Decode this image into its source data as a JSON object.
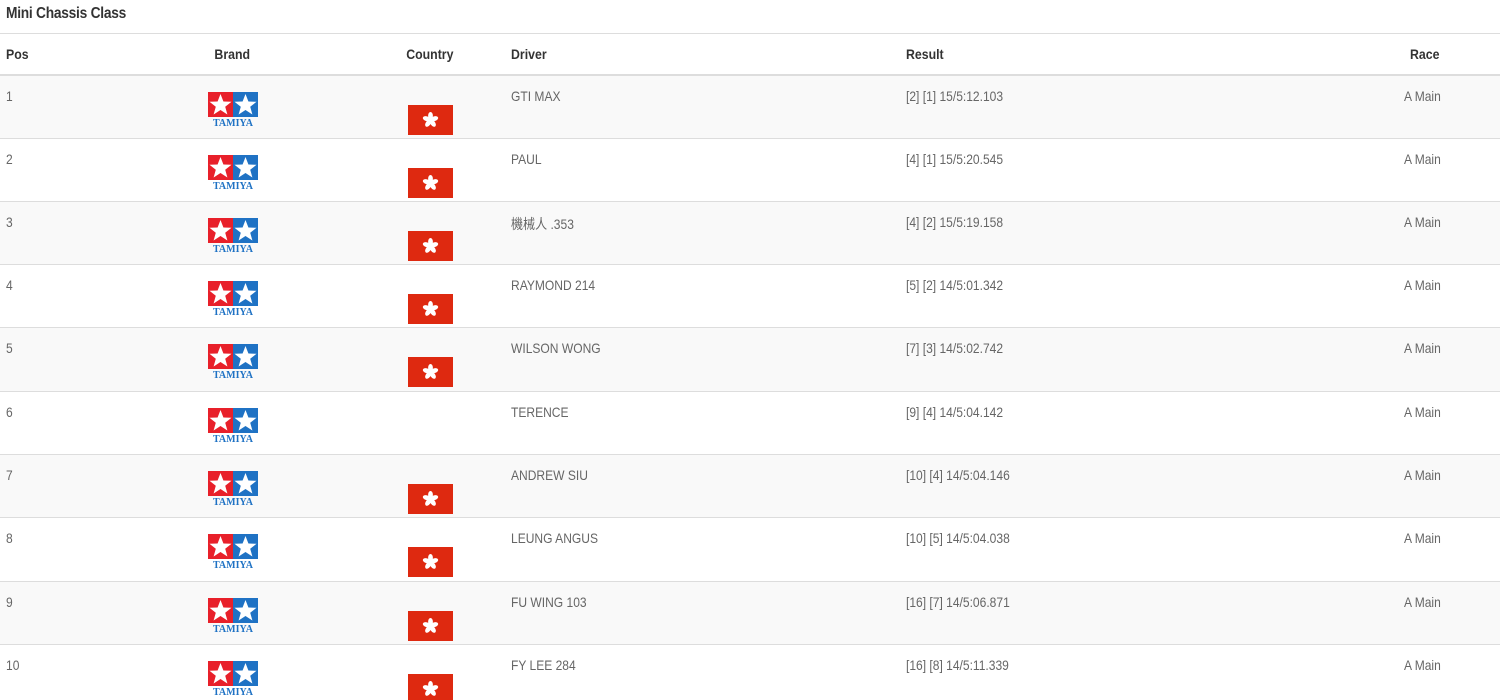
{
  "section": {
    "title": "Mini Chassis Class"
  },
  "columns": {
    "pos": "Pos",
    "brand": "Brand",
    "country": "Country",
    "driver": "Driver",
    "result": "Result",
    "race": "Race"
  },
  "colors": {
    "tamiya_red": "#e8202a",
    "tamiya_blue": "#1f72c4",
    "hk_red": "#de2910",
    "row_stripe": "#f9f9f9",
    "border": "#dddddd"
  },
  "icons": {
    "brand": "tamiya-logo-icon",
    "country": "hong-kong-flag-icon"
  },
  "brand_logo_text": "TAMIYA",
  "rows": [
    {
      "pos": "1",
      "driver": "GTI MAX",
      "result": "[2] [1] 15/5:12.103",
      "race": "A Main",
      "flag": true
    },
    {
      "pos": "2",
      "driver": "PAUL",
      "result": "[4] [1] 15/5:20.545",
      "race": "A Main",
      "flag": true
    },
    {
      "pos": "3",
      "driver": "機械人 .353",
      "result": "[4] [2] 15/5:19.158",
      "race": "A Main",
      "flag": true
    },
    {
      "pos": "4",
      "driver": "RAYMOND 214",
      "result": "[5] [2] 14/5:01.342",
      "race": "A Main",
      "flag": true
    },
    {
      "pos": "5",
      "driver": "WILSON WONG",
      "result": "[7] [3] 14/5:02.742",
      "race": "A Main",
      "flag": true
    },
    {
      "pos": "6",
      "driver": "TERENCE",
      "result": "[9] [4] 14/5:04.142",
      "race": "A Main",
      "flag": false
    },
    {
      "pos": "7",
      "driver": "ANDREW SIU",
      "result": "[10] [4] 14/5:04.146",
      "race": "A Main",
      "flag": true
    },
    {
      "pos": "8",
      "driver": "LEUNG ANGUS",
      "result": "[10] [5] 14/5:04.038",
      "race": "A Main",
      "flag": true
    },
    {
      "pos": "9",
      "driver": "FU WING 103",
      "result": "[16] [7] 14/5:06.871",
      "race": "A Main",
      "flag": true
    },
    {
      "pos": "10",
      "driver": "FY LEE 284",
      "result": "[16] [8] 14/5:11.339",
      "race": "A Main",
      "flag": true
    }
  ]
}
